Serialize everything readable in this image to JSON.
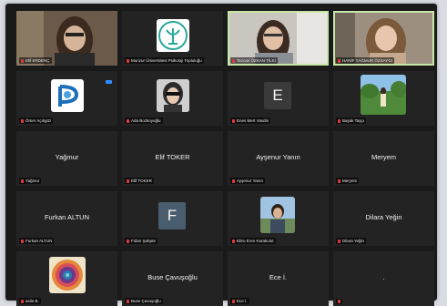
{
  "participants": [
    {
      "name": "Elif ERDENÇ"
    },
    {
      "name": "Munzur Üniversitesi Psikoloji Topluluğu"
    },
    {
      "name": "Tezcan ÖZKAN TİLKİ"
    },
    {
      "name": "HANİF YAĞMUR ÖZSAYGI"
    },
    {
      "name": "Ömer Açıkgöz"
    },
    {
      "name": "Ada Bozkoyuğlu"
    },
    {
      "name": "Enes Mert Vasdin",
      "initial": "E"
    },
    {
      "name": "Başak Taşçı"
    },
    {
      "name": "Yağmur",
      "display": "Yağmur"
    },
    {
      "name": "Elif TOKER",
      "display": "Elif TOKER"
    },
    {
      "name": "Ayşenur Yanın",
      "display": "Ayşenur Yanın"
    },
    {
      "name": "Meryem",
      "display": "Meryem"
    },
    {
      "name": "Furkan ALTUN",
      "display": "Furkan ALTUN"
    },
    {
      "name": "Fidan Şahpür",
      "initial": "F"
    },
    {
      "name": "Ebru Eren Karakulut"
    },
    {
      "name": "Dilara Yeğin",
      "display": "Dilara Yeğin"
    },
    {
      "name": "asile B."
    },
    {
      "name": "Buse Çavuşoğlu",
      "display": "Buse Çavuşoğlu"
    },
    {
      "name": "Ece İ.",
      "display": "Ece İ."
    },
    {
      "name": "."
    }
  ],
  "colors": {
    "background": "#1a1a1a",
    "tile": "#232323",
    "speaking_border": "#c8e6a8",
    "muted_mic": "#e23b3b",
    "accent_blue": "#2d8cff"
  }
}
